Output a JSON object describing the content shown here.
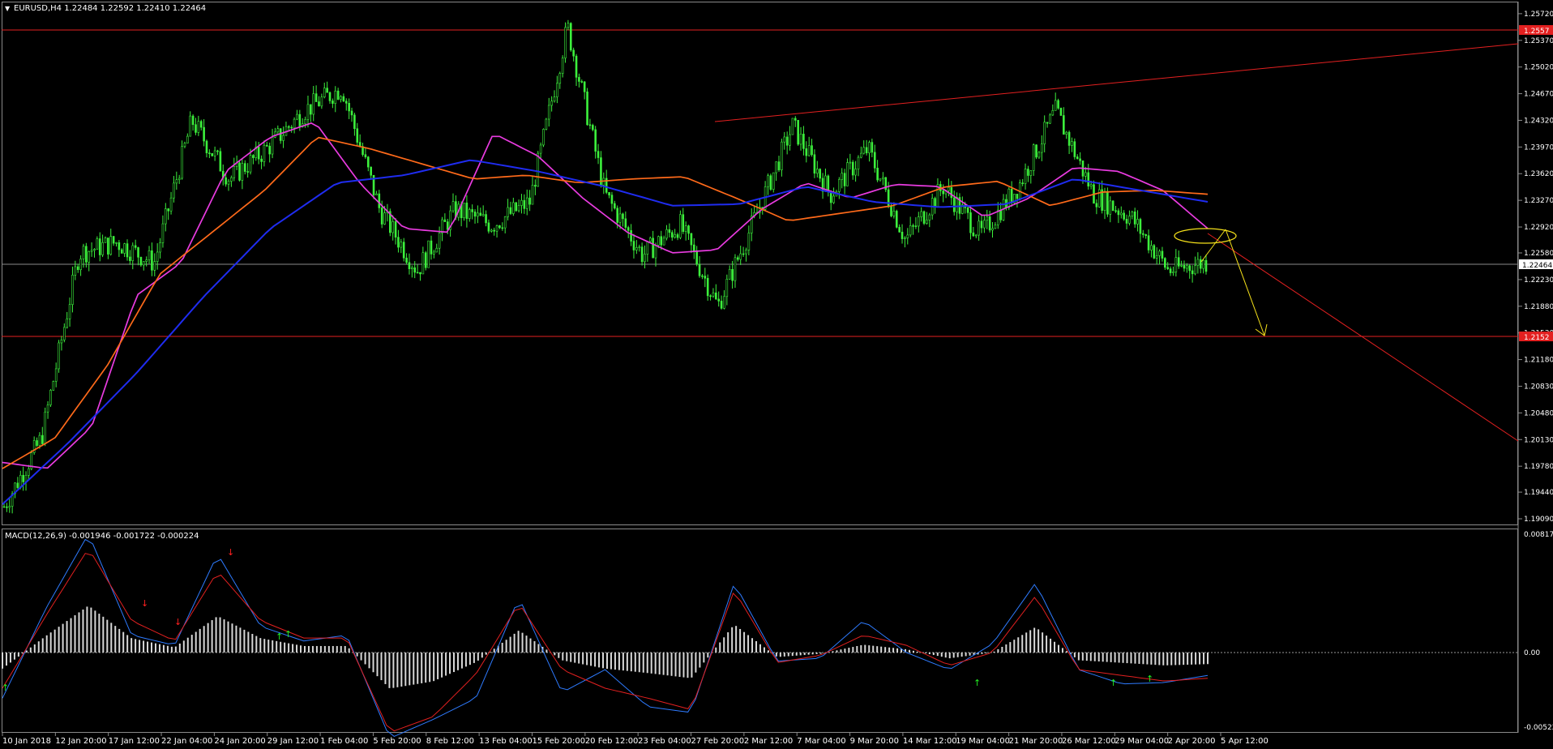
{
  "chart_data": [
    {
      "type": "candlestick",
      "title": "EURUSD,H4  1.22484 1.22592 1.22410 1.22464",
      "ylim": [
        1.1909,
        1.2574
      ],
      "y_ticks": [
        "1.25720",
        "1.25370",
        "1.25020",
        "1.24670",
        "1.24320",
        "1.23970",
        "1.23620",
        "1.23270",
        "1.22920",
        "1.22580",
        "1.22230",
        "1.21880",
        "1.21530",
        "1.21180",
        "1.20830",
        "1.20480",
        "1.20130",
        "1.19780",
        "1.19440",
        "1.19090"
      ],
      "x_ticks": [
        "10 Jan 2018",
        "12 Jan 20:00",
        "17 Jan 12:00",
        "22 Jan 04:00",
        "24 Jan 20:00",
        "29 Jan 12:00",
        "1 Feb 04:00",
        "5 Feb 20:00",
        "8 Feb 12:00",
        "13 Feb 04:00",
        "15 Feb 20:00",
        "20 Feb 12:00",
        "23 Feb 04:00",
        "27 Feb 20:00",
        "2 Mar 12:00",
        "7 Mar 04:00",
        "9 Mar 20:00",
        "14 Mar 12:00",
        "19 Mar 04:00",
        "21 Mar 20:00",
        "26 Mar 12:00",
        "29 Mar 04:00",
        "2 Apr 20:00",
        "5 Apr 12:00"
      ],
      "current_price_label": "1.22464",
      "resistance_label": "1.2557",
      "support_label": "1.2152",
      "resistance": 1.2557,
      "support": 1.2152,
      "close_anchors": [
        1.1925,
        1.2015,
        1.2258,
        1.2272,
        1.2245,
        1.2432,
        1.2355,
        1.2395,
        1.2445,
        1.2475,
        1.2315,
        1.2235,
        1.2315,
        1.2295,
        1.2325,
        1.2555,
        1.2335,
        1.2255,
        1.2295,
        1.2188,
        1.2305,
        1.2425,
        1.2335,
        1.2395,
        1.2275,
        1.2345,
        1.2282,
        1.2345,
        1.2445,
        1.2335,
        1.2305,
        1.2235,
        1.2246
      ],
      "ma_fast": [
        1.1983,
        1.1975,
        1.203,
        1.2202,
        1.2245,
        1.2365,
        1.241,
        1.243,
        1.235,
        1.229,
        1.2285,
        1.2415,
        1.2385,
        1.233,
        1.2285,
        1.2258,
        1.2262,
        1.2315,
        1.235,
        1.233,
        1.2348,
        1.2345,
        1.2305,
        1.233,
        1.237,
        1.2365,
        1.234,
        1.229
      ],
      "ma_medium": [
        1.1975,
        1.2015,
        1.211,
        1.223,
        1.2285,
        1.234,
        1.241,
        1.2395,
        1.2375,
        1.2355,
        1.236,
        1.235,
        1.2355,
        1.2358,
        1.233,
        1.23,
        1.231,
        1.232,
        1.2345,
        1.2352,
        1.232,
        1.2338,
        1.234,
        1.2335
      ],
      "ma_slow": [
        1.1928,
        1.201,
        1.21,
        1.22,
        1.229,
        1.235,
        1.236,
        1.238,
        1.2365,
        1.2345,
        1.232,
        1.2322,
        1.2345,
        1.2325,
        1.2318,
        1.2322,
        1.2355,
        1.234,
        1.2325
      ]
    },
    {
      "type": "macd",
      "title": "MACD(12,26,9) -0.001946 -0.001722 -0.000224",
      "ylim": [
        -0.005225,
        0.008173
      ],
      "y_ticks": [
        "0.008173",
        "0.00",
        "-0.005225"
      ],
      "macd": [
        -0.0032,
        0.003,
        0.0082,
        0.0012,
        0.0005,
        0.0068,
        0.0018,
        0.0008,
        0.0012,
        -0.006,
        -0.0047,
        -0.0032,
        0.0038,
        -0.0028,
        -0.0012,
        -0.0038,
        -0.0042,
        0.0048,
        -0.0006,
        -0.0004,
        0.0022,
        0.0,
        -0.0012,
        0.0006,
        0.0048,
        -0.0012,
        -0.0022,
        -0.0021,
        -0.0016
      ],
      "signal": [
        -0.0025,
        0.0025,
        0.0072,
        0.0022,
        0.0008,
        0.0056,
        0.0022,
        0.001,
        0.001,
        -0.0056,
        -0.0045,
        -0.0015,
        0.0034,
        -0.0012,
        -0.0025,
        -0.0032,
        -0.004,
        0.0043,
        -0.0007,
        -0.0002,
        0.0012,
        0.0005,
        -0.0009,
        0.0,
        0.0039,
        -0.0012,
        -0.0016,
        -0.002,
        -0.0018
      ]
    }
  ]
}
